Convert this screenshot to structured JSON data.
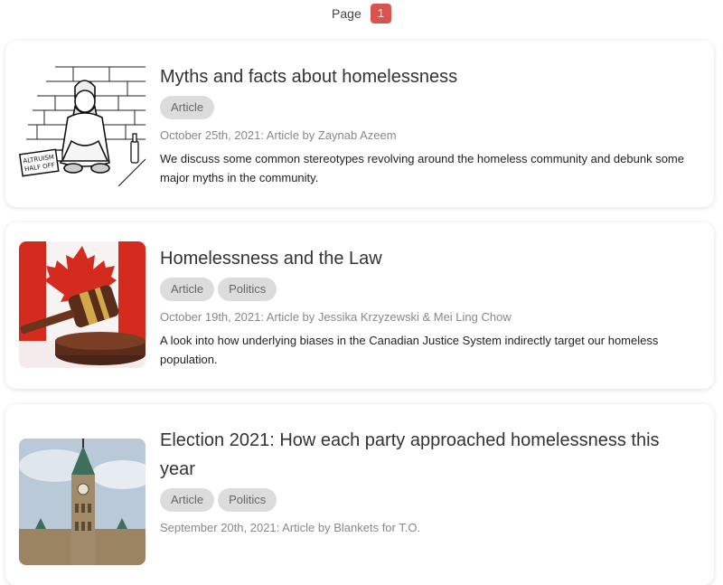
{
  "pagination": {
    "label": "Page",
    "current": "1"
  },
  "articles": [
    {
      "title": "Myths and facts about homelessness",
      "tags": [
        "Article"
      ],
      "meta": "October 25th, 2021: Article by Zaynab Azeem",
      "description": "We discuss some common stereotypes revolving around the homeless community and debunk some major myths in the community.",
      "sign_text_1": "ALTRUISM",
      "sign_text_2": "HALF OFF"
    },
    {
      "title": "Homelessness and the Law",
      "tags": [
        "Article",
        "Politics"
      ],
      "meta": "October 19th, 2021: Article by Jessika Krzyzewski & Mei Ling Chow",
      "description": "A look into how underlying biases in the Canadian Justice System indirectly target our homeless population."
    },
    {
      "title": "Election 2021: How each party approached homelessness this year",
      "tags": [
        "Article",
        "Politics"
      ],
      "meta": "September 20th, 2021: Article by Blankets for T.O.",
      "description": ""
    }
  ],
  "colors": {
    "page_badge": "#d9534f",
    "tag_bg": "#dcdcdc"
  }
}
